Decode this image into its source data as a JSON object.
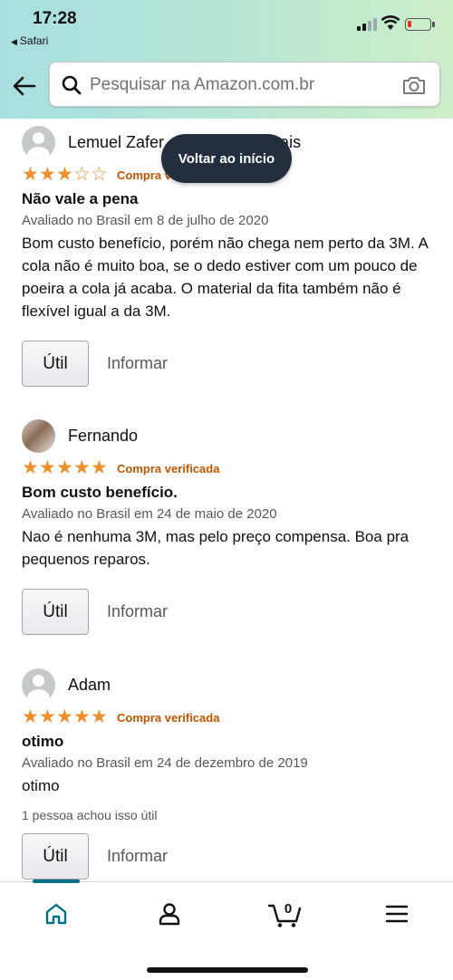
{
  "status_bar": {
    "time": "17:28",
    "back_app": "Safari"
  },
  "search": {
    "placeholder": "Pesquisar na Amazon.com.br"
  },
  "back_to_top": "Voltar ao início",
  "reviews": [
    {
      "author": "Lemuel Zafer",
      "author_tail": "rais",
      "stars": 3,
      "verified": "Compra v",
      "title": "Não vale a pena",
      "date": "Avaliado no Brasil em 8 de julho de 2020",
      "body": "Bom custo benefício, porém não chega nem perto da 3M. A cola não é muito boa, se o dedo estiver com um pouco de poeira a cola já acaba. O material da fita também não é flexível igual a da 3M.",
      "helpful_text": "",
      "util_label": "Útil",
      "report_label": "Informar"
    },
    {
      "author": "Fernando",
      "stars": 5,
      "verified": "Compra verificada",
      "title": "Bom custo benefício.",
      "date": "Avaliado no Brasil em 24 de maio de 2020",
      "body": "Nao é nenhuma 3M, mas pelo preço compensa. Boa pra pequenos reparos.",
      "helpful_text": "",
      "util_label": "Útil",
      "report_label": "Informar"
    },
    {
      "author": "Adam",
      "stars": 5,
      "verified": "Compra verificada",
      "title": "otimo",
      "date": "Avaliado no Brasil em 24 de dezembro de 2019",
      "body": "otimo",
      "helpful_text": "1 pessoa achou isso útil",
      "util_label": "Útil",
      "report_label": "Informar"
    }
  ],
  "bottom_nav": {
    "cart_count": "0",
    "active_tab": "home"
  },
  "colors": {
    "star": "#ee8f2b",
    "verified": "#c45500",
    "accent": "#007185",
    "pill": "#232f3e"
  },
  "icons": [
    "back-arrow-icon",
    "search-icon",
    "camera-icon",
    "home-icon",
    "account-icon",
    "cart-icon",
    "menu-icon"
  ]
}
